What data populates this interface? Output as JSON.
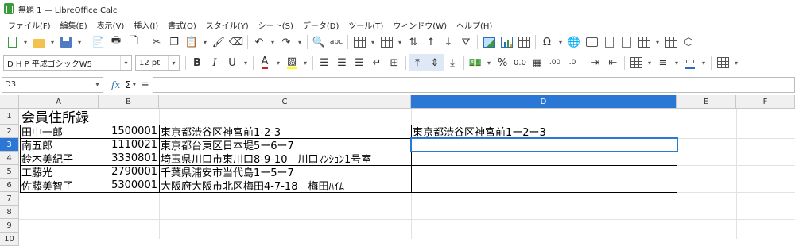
{
  "window": {
    "title": "無題 1 — LibreOffice Calc"
  },
  "menu": [
    "ファイル(F)",
    "編集(E)",
    "表示(V)",
    "挿入(I)",
    "書式(O)",
    "スタイル(Y)",
    "シート(S)",
    "データ(D)",
    "ツール(T)",
    "ウィンドウ(W)",
    "ヘルプ(H)"
  ],
  "format_bar": {
    "font_name": "D H P 平成ゴシックW5",
    "font_size": "12 pt"
  },
  "formula_bar": {
    "cell_ref": "D3",
    "formula": ""
  },
  "sheet": {
    "columns": [
      "A",
      "B",
      "C",
      "D",
      "E",
      "F"
    ],
    "active_column": "D",
    "rows": [
      "1",
      "2",
      "3",
      "4",
      "5",
      "6",
      "7",
      "8",
      "9",
      "10"
    ],
    "active_row": "3",
    "title": "会員住所録",
    "records": [
      {
        "name": "田中一郎",
        "zip": "1500001",
        "address": "東京都渋谷区神宮前1-2-3",
        "normalized": "東京都渋谷区神宮前1ー2ー3"
      },
      {
        "name": "南五郎",
        "zip": "1110021",
        "address": "東京都台東区日本堤5ー6ー7",
        "normalized": ""
      },
      {
        "name": "鈴木美紀子",
        "zip": "3330801",
        "address": "埼玉県川口市東川口8-9-10　川口ﾏﾝｼｮﾝ1号室",
        "normalized": ""
      },
      {
        "name": "工藤光",
        "zip": "2790001",
        "address": "千葉県浦安市当代島1ー5ー7",
        "normalized": ""
      },
      {
        "name": "佐藤美智子",
        "zip": "5300001",
        "address": "大阪府大阪市北区梅田4-7-18　梅田ﾊｲﾑ",
        "normalized": ""
      }
    ]
  },
  "colors": {
    "accent": "#2a77d6",
    "header_bg": "#f0f0f0"
  }
}
